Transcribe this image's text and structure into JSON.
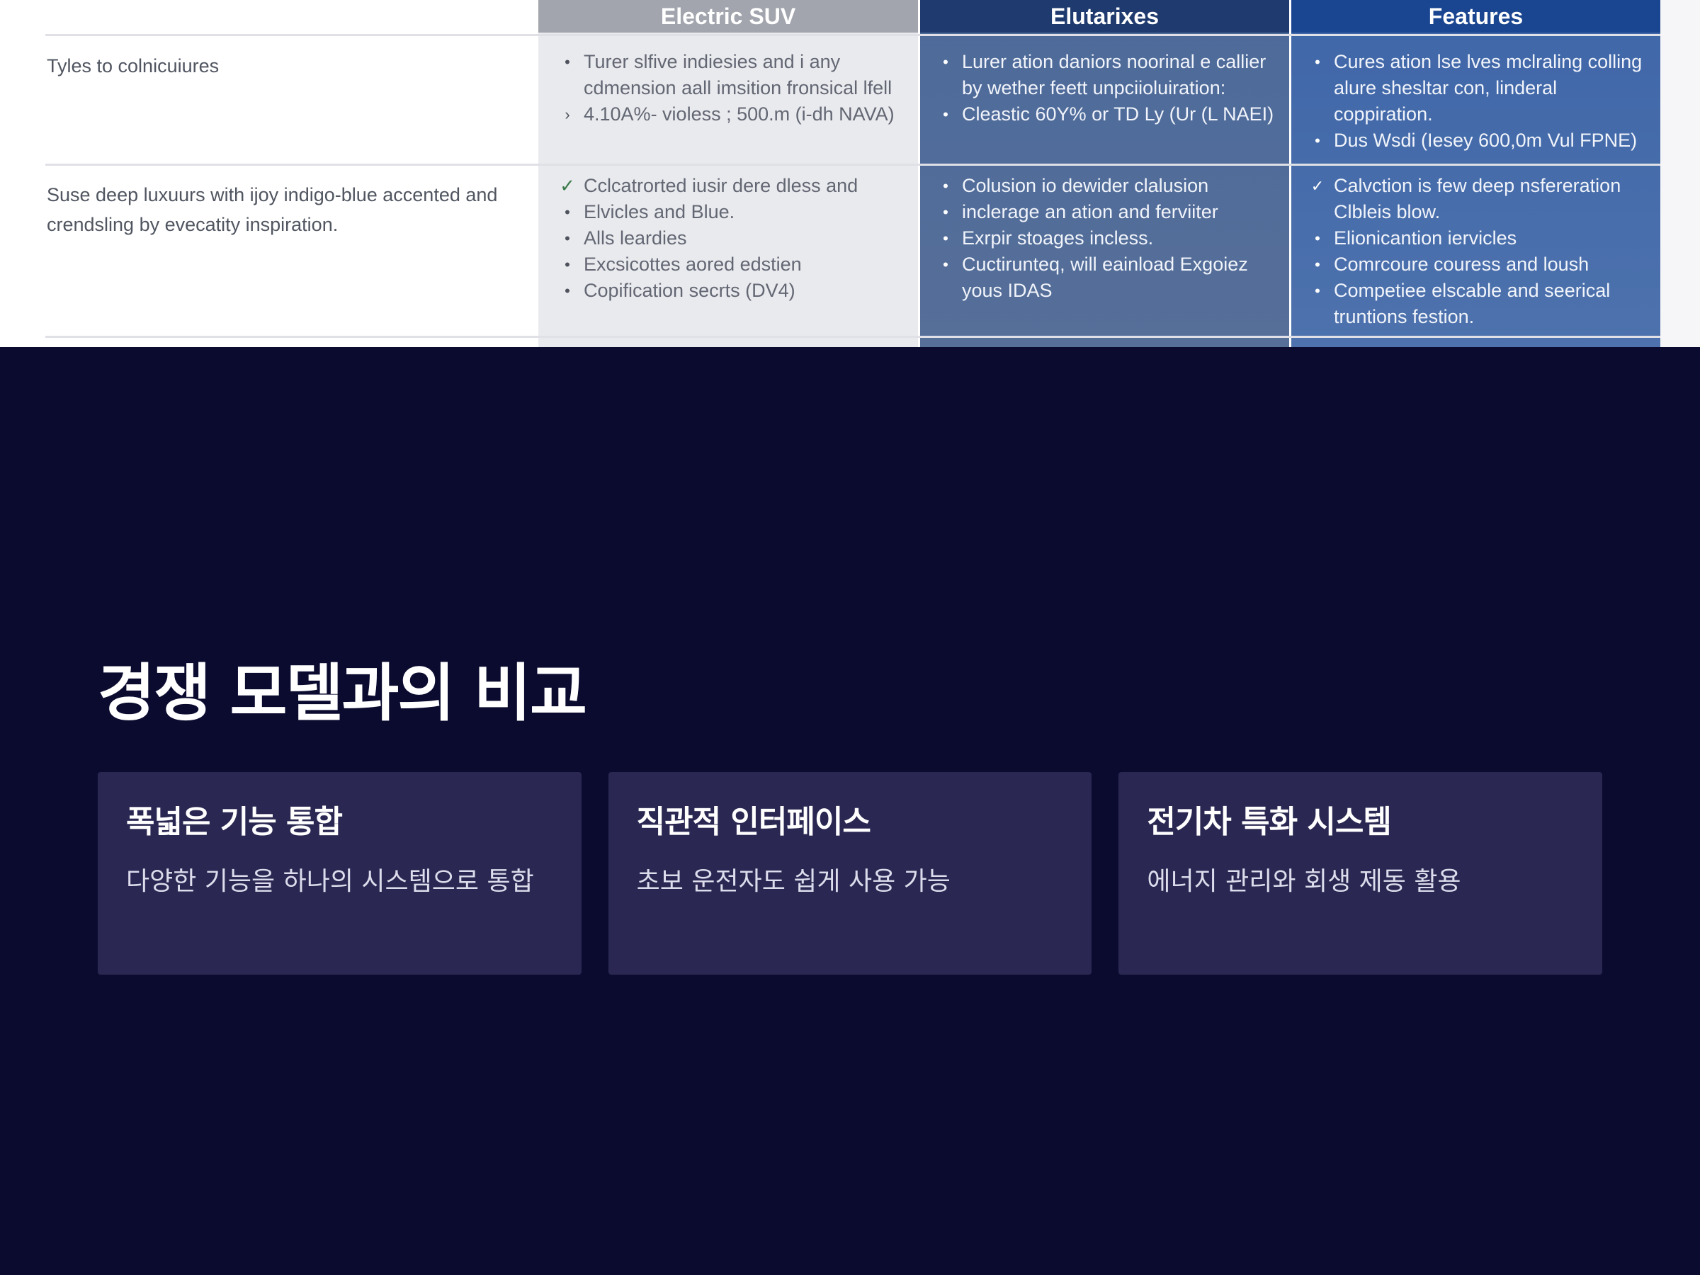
{
  "table": {
    "headers": [
      "Electric SUV",
      "Elutarixes",
      "Features"
    ],
    "rows": [
      {
        "label": "Tyles to colnicuiures",
        "ev": [
          {
            "marker": "•",
            "text": "Turer slfive indiesies and i any cdmension aall imsition fronsical lfell"
          },
          {
            "marker": "›",
            "text": "4.10A%- violess ; 500.m (i-dh NAVA)"
          }
        ],
        "lux": [
          {
            "marker": "•",
            "text": "Lurer ation daniors noorinal e callier by wether feett unpciioluiration:"
          },
          {
            "marker": "•",
            "text": "Cleastic 60Y% or TD Ly (Ur (L NAEI)"
          }
        ],
        "feat": [
          {
            "marker": "•",
            "text": "Cures ation lse lves mclraling colling alure shesltar con, linderal coppiration."
          },
          {
            "marker": "•",
            "text": "Dus Wsdi (Iesey 600,0m Vul FPNE)"
          }
        ]
      },
      {
        "label": "Suse deep luxuurs with ijoy indigo-blue accented and crendsling by evecatity inspiration.",
        "ev": [
          {
            "marker": "✓",
            "text": "Cclcatrorted iusir dere dless and"
          },
          {
            "marker": "•",
            "text": "Elvicles and Blue."
          },
          {
            "marker": "•",
            "text": "Alls leardies"
          },
          {
            "marker": "•",
            "text": "Excsicottes aored edstien"
          },
          {
            "marker": "•",
            "text": "Copification secrts (DV4)"
          }
        ],
        "lux": [
          {
            "marker": "•",
            "text": "Colusion io dewider clalusion"
          },
          {
            "marker": "•",
            "text": "inclerage an ation and ferviiter"
          },
          {
            "marker": "•",
            "text": "Exrpir stoages incless."
          },
          {
            "marker": "•",
            "text": "Cuctirunteq, will eainload Exgoiez yous IDAS"
          }
        ],
        "feat": [
          {
            "marker": "✓",
            "text": "Calvction is few deep nsfereration Clbleis blow."
          },
          {
            "marker": "•",
            "text": "Elionicantion iervicles"
          },
          {
            "marker": "•",
            "text": "Comrcoure couress and loush"
          },
          {
            "marker": "•",
            "text": "Competiee elscable and seerical truntions festion."
          }
        ]
      }
    ]
  },
  "section": {
    "title": "경쟁 모델과의 비교",
    "cards": [
      {
        "title": "폭넓은 기능 통합",
        "desc": "다양한 기능을 하나의 시스템으로 통합"
      },
      {
        "title": "직관적 인터페이스",
        "desc": "초보 운전자도 쉽게 사용 가능"
      },
      {
        "title": "전기차 특화 시스템",
        "desc": "에너지 관리와 회생 제동 활용"
      }
    ]
  },
  "colors": {
    "background": "#0b0b30",
    "card": "#2a2852",
    "header_ev": "#a2a5ad",
    "header_lux": "#1f3a6e",
    "header_feat": "#1a4590"
  }
}
